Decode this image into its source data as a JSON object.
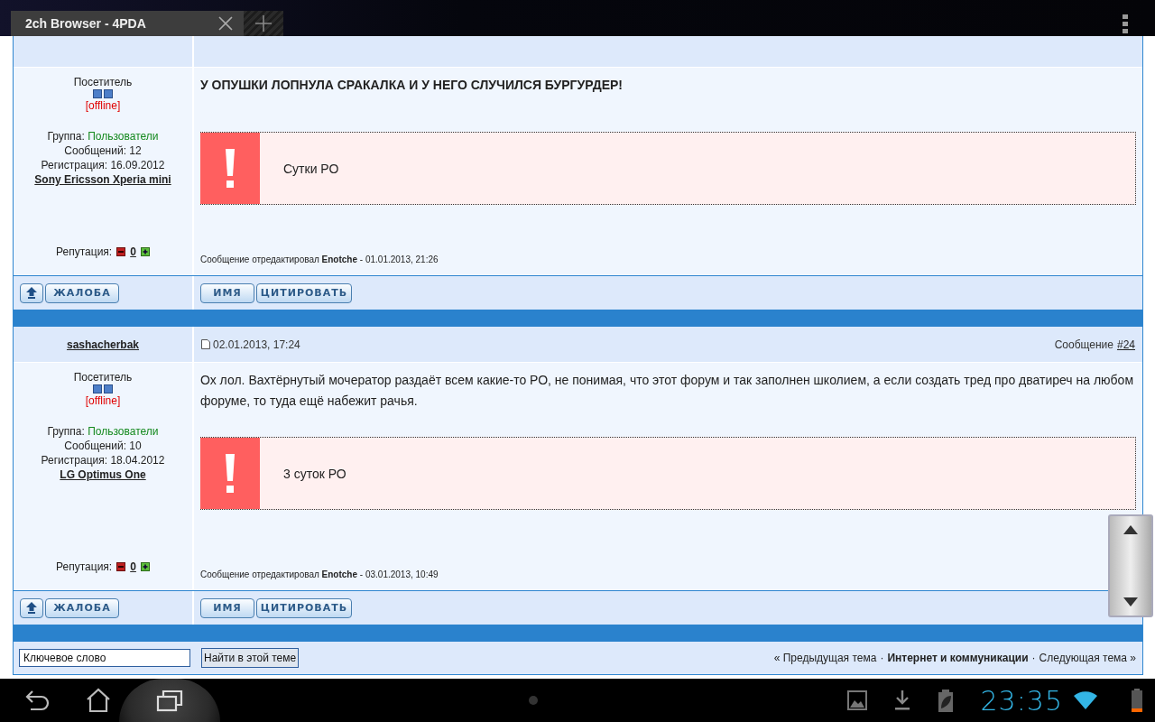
{
  "tab": {
    "title": "2ch Browser - 4PDA"
  },
  "posts": [
    {
      "rank": "Посетитель",
      "status": "[offline]",
      "group_label": "Группа:",
      "group": "Пользователи",
      "messages": "Сообщений: 12",
      "registered": "Регистрация: 16.09.2012",
      "device": "Sony Ericsson Xperia mini",
      "reputation_label": "Репутация:",
      "reputation": "0",
      "text": "У ОПУШКИ ЛОПНУЛА СРАКАЛКА И У НЕГО СЛУЧИЛСЯ БУРГУРДЕР!",
      "bold": true,
      "notice": "Сутки РО",
      "edited": "Сообщение отредактировал **Enotche** - 01.01.2013, 21:26",
      "buttons_left": [
        "ЖАЛОБА"
      ],
      "buttons_right": [
        "ИМЯ",
        "ЦИТИРОВАТЬ"
      ]
    },
    {
      "author": "sashacherbak",
      "date": "02.01.2013, 17:24",
      "number_label": "Сообщение",
      "number": "#24",
      "rank": "Посетитель",
      "status": "[offline]",
      "group_label": "Группа:",
      "group": "Пользователи",
      "messages": "Сообщений: 10",
      "registered": "Регистрация: 18.04.2012",
      "device": "LG Optimus One",
      "reputation_label": "Репутация:",
      "reputation": "0",
      "text": "Ох лол. Вахтёрнутый мочератор раздаёт всем какие-то РО, не понимая, что этот форум и так заполнен школием, а если создать тред про дватиреч на любом форуме, то туда ещё набежит рачья.",
      "bold": false,
      "notice": "3 суток РО",
      "edited": "Сообщение отредактировал **Enotche** - 03.01.2013, 10:49",
      "buttons_left": [
        "ЖАЛОБА"
      ],
      "buttons_right": [
        "ИМЯ",
        "ЦИТИРОВАТЬ"
      ]
    }
  ],
  "search": {
    "placeholder": "Ключевое слово",
    "button": "Найти в этой теме"
  },
  "topic_nav": [
    {
      "kind": "link",
      "text": "« Предыдущая тема"
    },
    {
      "kind": "sep",
      "text": "·"
    },
    {
      "kind": "current",
      "text": "Интернет и коммуникации"
    },
    {
      "kind": "sep",
      "text": "·"
    },
    {
      "kind": "link",
      "text": "Следующая тема »"
    }
  ],
  "status_bar": {
    "time": "23:35"
  }
}
